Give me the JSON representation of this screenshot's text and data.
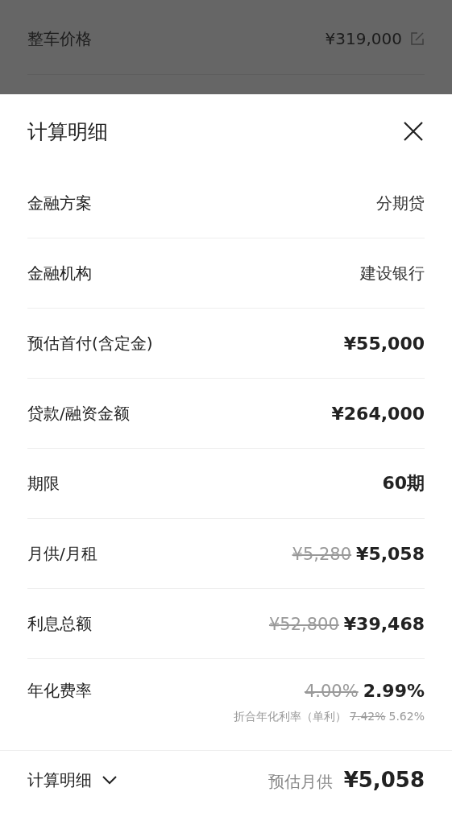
{
  "background_row": {
    "label": "整车价格",
    "value": "¥319,000"
  },
  "sheet": {
    "title": "计算明细",
    "rows": [
      {
        "label": "金融方案",
        "kind": "plain",
        "value": "分期贷"
      },
      {
        "label": "金融机构",
        "kind": "plain",
        "value": "建设银行"
      },
      {
        "label": "预估首付(含定金)",
        "kind": "amount",
        "value": "¥55,000"
      },
      {
        "label": "贷款/融资金额",
        "kind": "amount",
        "value": "¥264,000"
      },
      {
        "label": "期限",
        "kind": "amount",
        "value": "60期"
      },
      {
        "label": "月供/月租",
        "kind": "amount",
        "was": "¥5,280",
        "value": "¥5,058"
      },
      {
        "label": "利息总额",
        "kind": "amount",
        "was": "¥52,800",
        "value": "¥39,468"
      },
      {
        "label": "年化费率",
        "kind": "amount",
        "was": "4.00%",
        "value": "2.99%",
        "note": {
          "label": "折合年化利率（单利）",
          "was": "7.42%",
          "value": "5.62%"
        }
      }
    ]
  },
  "footer": {
    "toggle": "计算明细",
    "summary_label": "预估月供",
    "summary_value": "¥5,058"
  }
}
